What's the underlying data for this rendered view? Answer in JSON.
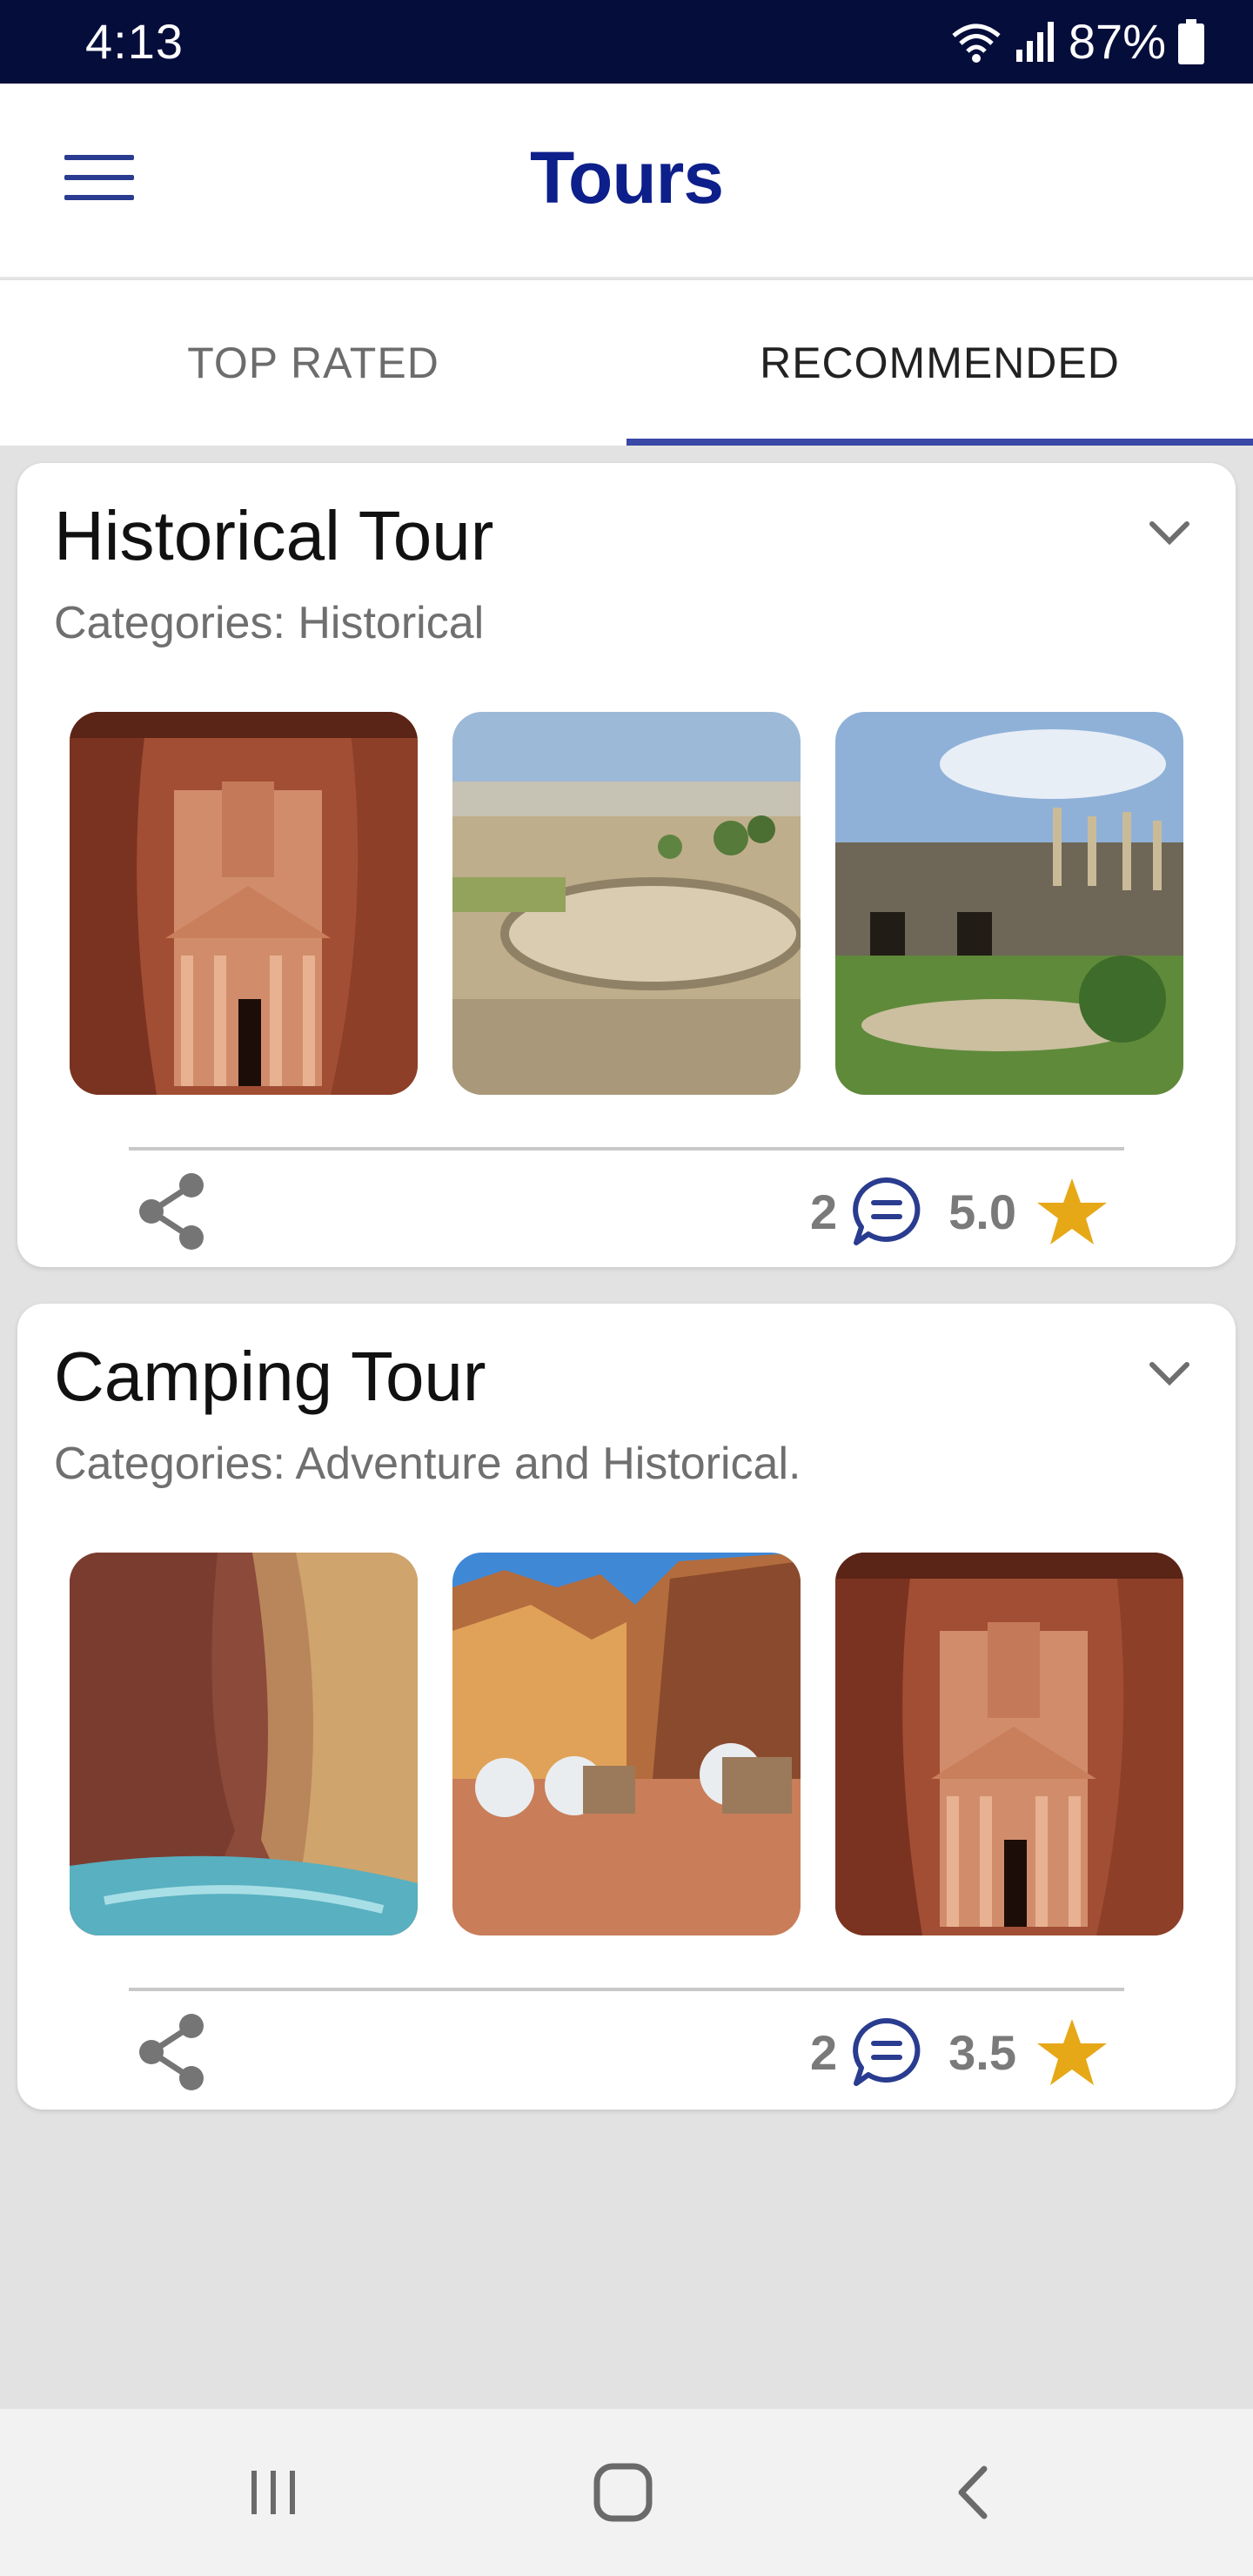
{
  "status_bar": {
    "time": "4:13",
    "battery": "87%",
    "icons": [
      "wifi-icon",
      "signal-icon",
      "battery-icon"
    ]
  },
  "app_bar": {
    "title": "Tours",
    "menu_icon": "menu-icon",
    "accent_color": "#0d1f8a"
  },
  "tabs": [
    {
      "label": "TOP RATED",
      "active": false
    },
    {
      "label": "RECOMMENDED",
      "active": true
    }
  ],
  "tours": [
    {
      "title": "Historical Tour",
      "categories": "Categories: Historical",
      "images": [
        "petra-treasury-photo",
        "jerash-oval-plaza-photo",
        "jerash-ruins-columns-photo"
      ],
      "comments": "2",
      "rating": "5.0"
    },
    {
      "title": "Camping Tour",
      "categories": "Categories: Adventure and Historical.",
      "images": [
        "wadi-mujib-canyon-photo",
        "wadi-rum-bubble-camp-photo",
        "petra-treasury-photo"
      ],
      "comments": "2",
      "rating": "3.5"
    }
  ],
  "colors": {
    "status_bar": "#050d3b",
    "tab_indicator": "#3a48a6",
    "star": "#e6a817",
    "comment_icon": "#2a3c8f"
  },
  "nav_bar": {
    "icons": [
      "recent-apps-icon",
      "home-icon",
      "back-icon"
    ]
  }
}
